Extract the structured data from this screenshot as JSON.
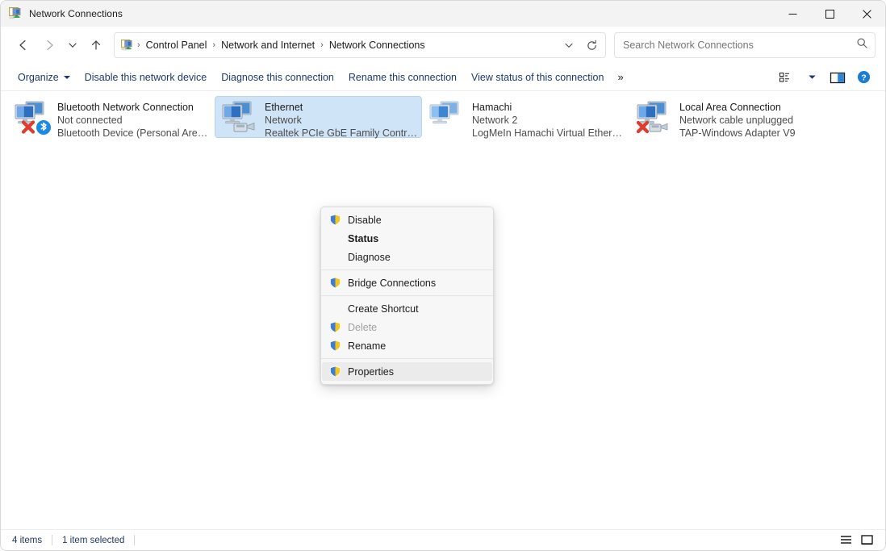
{
  "window": {
    "title": "Network Connections",
    "app_icon": "network-connections-icon",
    "controls": {
      "minimize": "minimize-icon",
      "maximize": "maximize-icon",
      "close": "close-icon"
    }
  },
  "navbar": {
    "back": "back-arrow-icon",
    "forward": "forward-arrow-icon",
    "recent": "chevron-down-icon",
    "up": "up-arrow-icon",
    "breadcrumb": {
      "icon": "network-connections-icon",
      "items": [
        "Control Panel",
        "Network and Internet",
        "Network Connections"
      ],
      "separator": "›"
    },
    "address_dropdown": "chevron-down-icon",
    "refresh": "refresh-icon"
  },
  "search": {
    "placeholder": "Search Network Connections",
    "value": "",
    "icon": "search-icon"
  },
  "commandbar": {
    "items": [
      {
        "label": "Organize",
        "has_caret": true
      },
      {
        "label": "Disable this network device",
        "has_caret": false
      },
      {
        "label": "Diagnose this connection",
        "has_caret": false
      },
      {
        "label": "Rename this connection",
        "has_caret": false
      },
      {
        "label": "View status of this connection",
        "has_caret": false
      }
    ],
    "overflow": "»",
    "layout_icon": "layout-options-icon",
    "layout_caret": "chevron-down-icon",
    "preview_pane_icon": "preview-pane-icon",
    "help_icon": "help-icon"
  },
  "connections": [
    {
      "name": "Bluetooth Network Connection",
      "status": "Not connected",
      "device": "Bluetooth Device (Personal Area ...",
      "icon": "network-adapter-icon",
      "badge": "red-x-icon",
      "overlay": "bluetooth-icon",
      "selected": false
    },
    {
      "name": "Ethernet",
      "status": "Network",
      "device": "Realtek PCIe GbE Family Controller",
      "icon": "network-adapter-icon",
      "badge": "none",
      "overlay": "ethernet-plug-icon",
      "selected": true
    },
    {
      "name": "Hamachi",
      "status": "Network 2",
      "device": "LogMeIn Hamachi Virtual Etherne...",
      "icon": "virtual-network-adapter-icon",
      "badge": "none",
      "overlay": "none",
      "selected": false
    },
    {
      "name": "Local Area Connection",
      "status": "Network cable unplugged",
      "device": "TAP-Windows Adapter V9",
      "icon": "network-adapter-icon",
      "badge": "red-x-icon",
      "overlay": "ethernet-plug-icon",
      "selected": false
    }
  ],
  "context_menu": {
    "groups": [
      [
        {
          "label": "Disable",
          "shield": true,
          "bold": false,
          "disabled": false,
          "hovered": false
        },
        {
          "label": "Status",
          "shield": false,
          "bold": true,
          "disabled": false,
          "hovered": false
        },
        {
          "label": "Diagnose",
          "shield": false,
          "bold": false,
          "disabled": false,
          "hovered": false
        }
      ],
      [
        {
          "label": "Bridge Connections",
          "shield": true,
          "bold": false,
          "disabled": false,
          "hovered": false
        }
      ],
      [
        {
          "label": "Create Shortcut",
          "shield": false,
          "bold": false,
          "disabled": false,
          "hovered": false
        },
        {
          "label": "Delete",
          "shield": true,
          "bold": false,
          "disabled": true,
          "hovered": false
        },
        {
          "label": "Rename",
          "shield": true,
          "bold": false,
          "disabled": false,
          "hovered": false
        }
      ],
      [
        {
          "label": "Properties",
          "shield": true,
          "bold": false,
          "disabled": false,
          "hovered": true
        }
      ]
    ]
  },
  "statusbar": {
    "item_count": "4 items",
    "selection": "1 item selected",
    "details_view_icon": "details-view-icon",
    "large_icons_view_icon": "large-icons-view-icon"
  },
  "colors": {
    "selection_bg": "#cfe4f7",
    "selection_border": "#b6d5f0",
    "command_link": "#1b3a6b",
    "titlebar_bg": "#f3f3f3",
    "menu_bg": "#f7f7f7",
    "menu_hover": "#ebebeb",
    "shield_blue": "#3b7dd8",
    "shield_gold": "#f5c518",
    "red_x": "#e23b2e",
    "help_blue": "#1a7fd4"
  }
}
